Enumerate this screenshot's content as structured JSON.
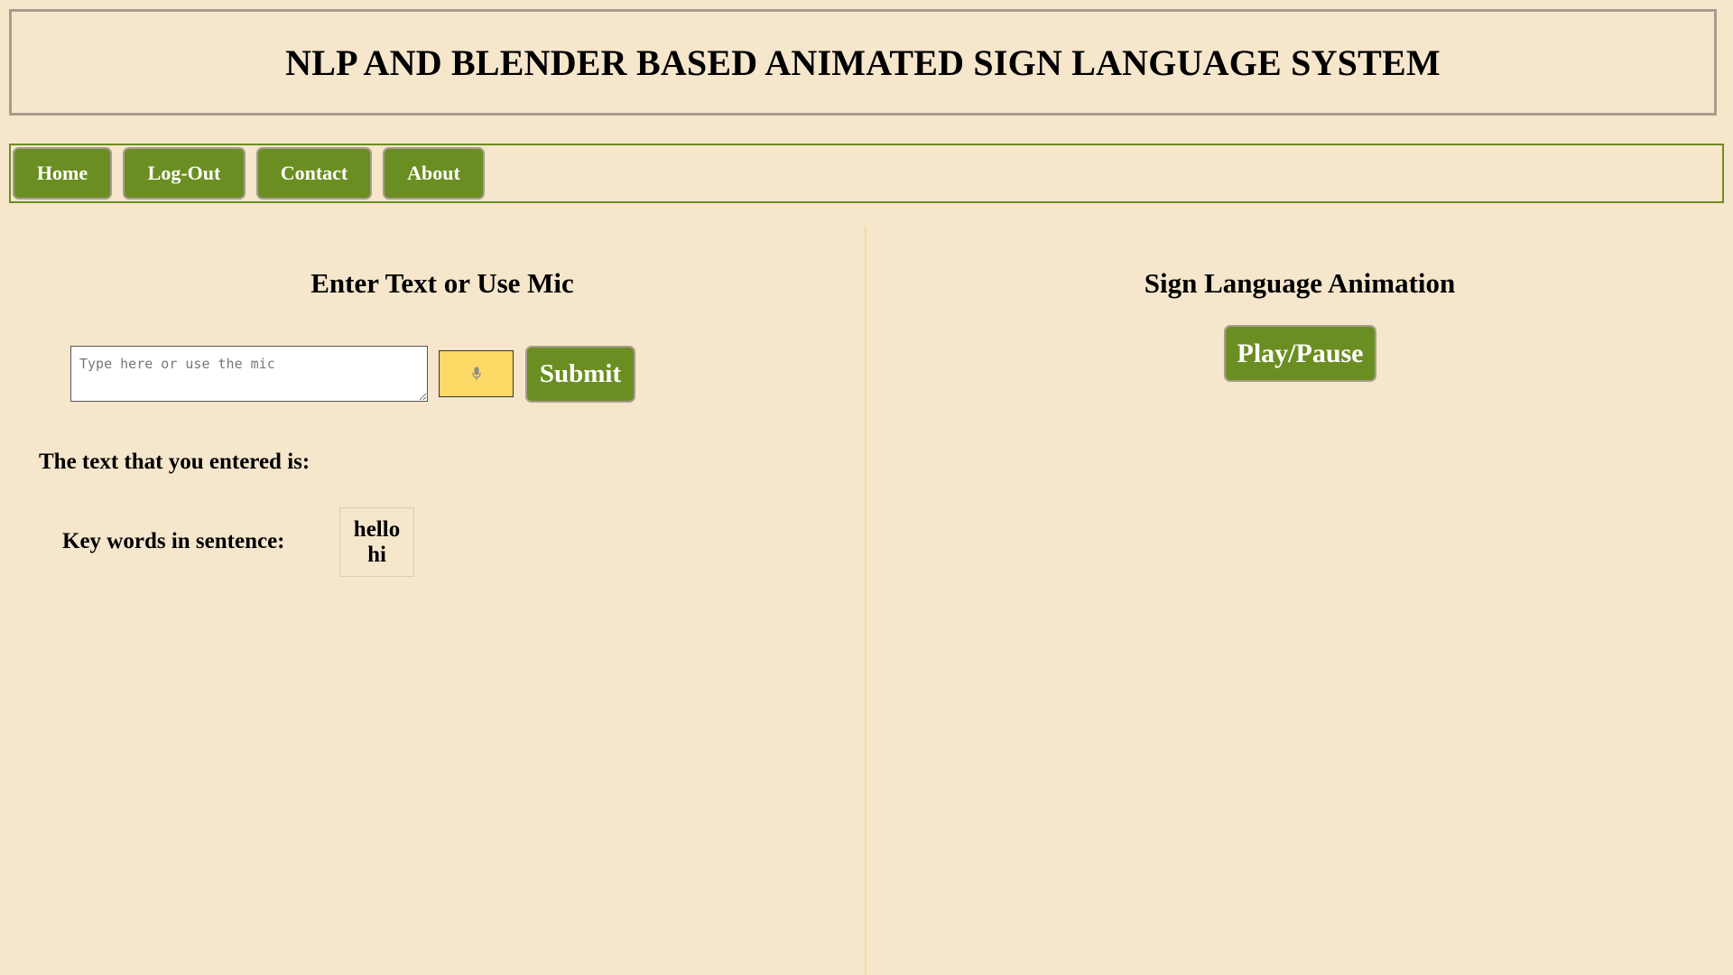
{
  "header": {
    "title": "NLP AND BLENDER BASED ANIMATED SIGN LANGUAGE SYSTEM"
  },
  "nav": {
    "items": [
      {
        "label": "Home"
      },
      {
        "label": "Log-Out"
      },
      {
        "label": "Contact"
      },
      {
        "label": "About"
      }
    ]
  },
  "input_panel": {
    "title": "Enter Text or Use Mic",
    "text_input": {
      "placeholder": "Type here or use the mic",
      "value": ""
    },
    "mic_button": {
      "icon": "microphone-icon"
    },
    "submit_label": "Submit",
    "entered_text_label": "The text that you entered is:",
    "entered_text_value": "",
    "keywords_label": "Key words in sentence:",
    "keywords": [
      "hello",
      "hi"
    ]
  },
  "animation_panel": {
    "title": "Sign Language Animation",
    "play_pause_label": "Play/Pause"
  },
  "colors": {
    "background": "#f5e6cc",
    "accent_green": "#6b8e23",
    "mic_button_yellow": "#ffd966",
    "header_border": "#a89c8c",
    "divider": "#f7d9a0"
  }
}
